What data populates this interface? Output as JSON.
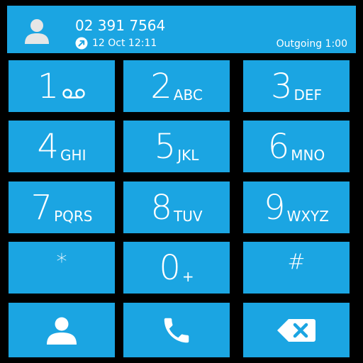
{
  "header": {
    "contact_icon": "person-icon",
    "phone_number": "02 391 7564",
    "call_type_icon": "outgoing-call-icon",
    "datetime": "12 Oct 12:11",
    "call_status": "Outgoing 1:00"
  },
  "keypad": {
    "keys": [
      {
        "digit": "1",
        "letters": "",
        "extra_icon": "voicemail-icon"
      },
      {
        "digit": "2",
        "letters": "ABC"
      },
      {
        "digit": "3",
        "letters": "DEF"
      },
      {
        "digit": "4",
        "letters": "GHI"
      },
      {
        "digit": "5",
        "letters": "JKL"
      },
      {
        "digit": "6",
        "letters": "MNO"
      },
      {
        "digit": "7",
        "letters": "PQRS"
      },
      {
        "digit": "8",
        "letters": "TUV"
      },
      {
        "digit": "9",
        "letters": "WXYZ"
      },
      {
        "digit": "*",
        "letters": ""
      },
      {
        "digit": "0",
        "letters": "+"
      },
      {
        "digit": "#",
        "letters": ""
      }
    ]
  },
  "actions": {
    "contacts_icon": "person-icon",
    "call_icon": "phone-icon",
    "backspace_icon": "backspace-icon"
  },
  "colors": {
    "key_background": "#1ba5e2",
    "background": "#000000",
    "text": "#ffffff"
  }
}
